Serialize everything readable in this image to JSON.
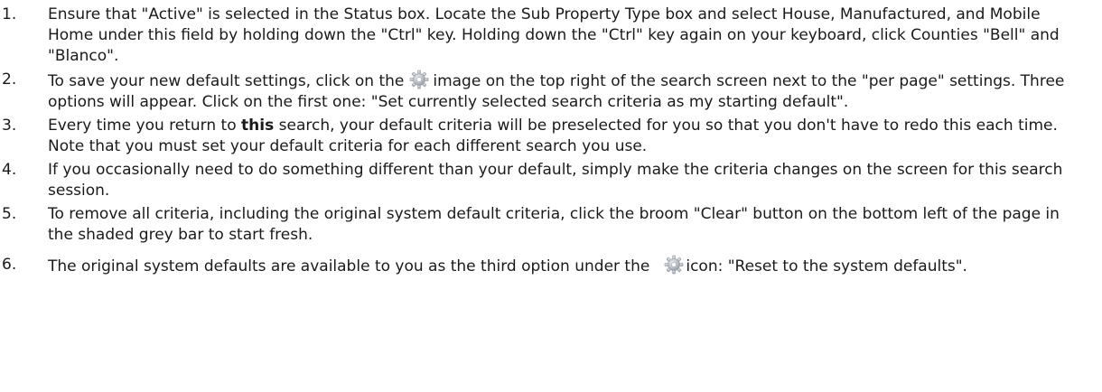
{
  "steps": [
    {
      "number": "1.",
      "text": "Ensure that \"Active\" is selected in the Status box.  Locate the Sub Property Type box and select House, Manufactured, and Mobile Home under this field by holding down the \"Ctrl\" key.  Holding down the \"Ctrl\" key again on your keyboard, click Counties \"Bell\" and \"Blanco\"."
    },
    {
      "number": "2.",
      "text_before": "To save your new default settings, click on the",
      "icon": "gear-icon",
      "text_after": "image on the top right of the search screen next to the \"per page\" settings. Three options will appear. Click on the first one: \"Set currently selected search criteria as my starting default\"."
    },
    {
      "number": "3.",
      "text_before": "Every time you return to",
      "bold": "this",
      "text_after": "search, your default criteria will be preselected for you so that you don't have to redo this each time. Note that you must set your default criteria for each different search you use."
    },
    {
      "number": "4.",
      "text": "If you occasionally need to do something different than your default, simply make the criteria changes on the screen for this search session."
    },
    {
      "number": "5.",
      "text": "To remove all criteria, including the original system default criteria,  click the  broom \"Clear\" button on the bottom left of the page in the shaded grey bar to start fresh."
    },
    {
      "number": "6.",
      "text_before": "The original system defaults are available to you as the third option under the",
      "icon": "gear-icon",
      "text_after": "icon: \"Reset to the system defaults\"."
    }
  ],
  "colors": {
    "text": "#1a1a1a",
    "gear": "#b9bfc6",
    "gear_dark": "#8f969e"
  }
}
